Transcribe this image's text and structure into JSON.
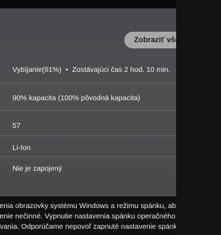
{
  "header": {
    "show_button_label": "Zobraziť všetko"
  },
  "battery": {
    "status": "Vybíjanie(91%)",
    "separator": "•",
    "time_remaining": "Zostávajúci čas 2 hod. 10 min.",
    "capacity": "90% kapacita (100% pôvodná kapacita)",
    "cycle_count": "57",
    "chemistry": "Li-Ion",
    "plugged_state": "Nie je zapojený"
  },
  "description": {
    "lines": [
      "venia obrazovky systému Windows a režimu spánku, aby s",
      "venie nečinné. Vypnutie nastavenia spánku operačného sy",
      "ovania. Odporúčame nepovoľ zapnuté nastavenie spánku z"
    ]
  },
  "colors": {
    "panel": "#4c4c50",
    "button_bg": "#a9a9ab",
    "text": "#f3f3f3",
    "background": "#111113"
  }
}
